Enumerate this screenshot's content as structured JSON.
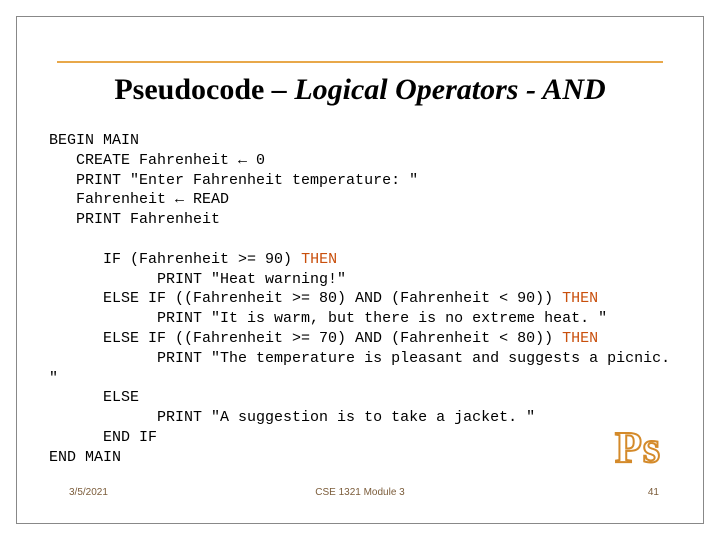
{
  "title_prefix": "Pseudocode ",
  "title_italic": "– Logical Operators - AND",
  "code": {
    "l1": "BEGIN MAIN",
    "l2": "   CREATE Fahrenheit ← 0",
    "l3": "   PRINT \"Enter Fahrenheit temperature: \"",
    "l4": "   Fahrenheit ← READ",
    "l5": "   PRINT Fahrenheit",
    "l6": "",
    "l7a": "      IF (Fahrenheit >= 90) ",
    "l7b": "THEN",
    "l8": "            PRINT \"Heat warning!\"",
    "l9a": "      ELSE IF ((Fahrenheit >= 80) AND (Fahrenheit < 90)) ",
    "l9b": "THEN",
    "l10": "            PRINT \"It is warm, but there is no extreme heat. \"",
    "l11a": "      ELSE IF ((Fahrenheit >= 70) AND (Fahrenheit < 80)) ",
    "l11b": "THEN",
    "l12": "            PRINT \"The temperature is pleasant and suggests a picnic. \"",
    "l13": "      ELSE",
    "l14": "            PRINT \"A suggestion is to take a jacket. \"",
    "l15": "      END IF",
    "l16": "END MAIN"
  },
  "footer": {
    "date": "3/5/2021",
    "center": "CSE 1321 Module 3",
    "page": "41"
  },
  "badge": "Ps"
}
